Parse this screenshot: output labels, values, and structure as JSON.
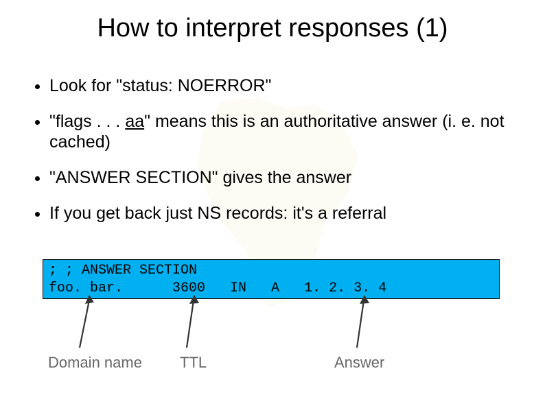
{
  "title": "How to interpret responses (1)",
  "bullets": {
    "b1": "Look for \"status: NOERROR\"",
    "b2_pre": "\"flags . . . ",
    "b2_aa": "aa",
    "b2_post": "\" means this is an authoritative answer (i. e. not cached)",
    "b3": "\"ANSWER SECTION\" gives the answer",
    "b4": "If you get back just NS records: it's a referral"
  },
  "code": {
    "line1": "; ; ANSWER SECTION",
    "line2": "foo. bar.      3600   IN   A   1. 2. 3. 4"
  },
  "labels": {
    "domain": "Domain name",
    "ttl": "TTL",
    "answer": "Answer"
  }
}
